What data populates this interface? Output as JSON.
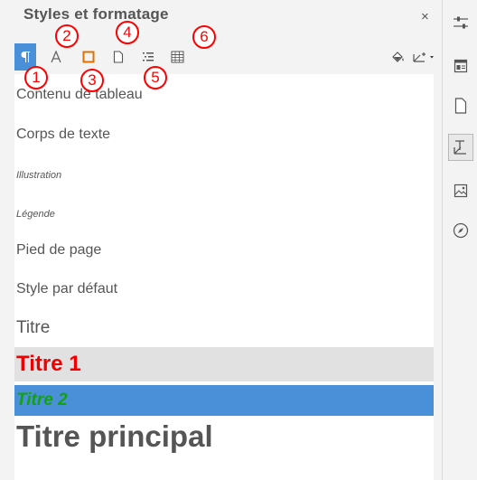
{
  "panel": {
    "title": "Styles et formatage",
    "close_label": "×"
  },
  "toolbar": {
    "buttons": [
      {
        "name": "paragraph-styles",
        "icon": "pilcrow-icon",
        "active": true
      },
      {
        "name": "character-styles",
        "icon": "character-a-icon"
      },
      {
        "name": "frame-styles",
        "icon": "frame-icon"
      },
      {
        "name": "page-styles",
        "icon": "page-icon"
      },
      {
        "name": "list-styles",
        "icon": "list-icon"
      },
      {
        "name": "table-styles",
        "icon": "table-icon"
      }
    ],
    "right_buttons": [
      {
        "name": "fill-format-mode",
        "icon": "paint-bucket-icon"
      },
      {
        "name": "new-style-from-selection",
        "icon": "new-style-icon"
      }
    ]
  },
  "annotations": [
    "1",
    "2",
    "3",
    "4",
    "5",
    "6"
  ],
  "styles": [
    {
      "label": "Contenu de tableau"
    },
    {
      "label": "Corps de texte"
    },
    {
      "label": "Illustration"
    },
    {
      "label": "Légende"
    },
    {
      "label": "Pied de page"
    },
    {
      "label": "Style par défaut"
    },
    {
      "label": "Titre"
    },
    {
      "label": "Titre 1"
    },
    {
      "label": "Titre 2",
      "selected": true
    },
    {
      "label": "Titre principal"
    }
  ],
  "colors": {
    "accent": "#4a90d9",
    "annotation": "#ff0000",
    "titre1": "#ee0000",
    "titre2": "#14a014",
    "hover_row": "#e1e1e1"
  },
  "sidebar": {
    "buttons": [
      {
        "name": "properties",
        "icon": "sliders-icon"
      },
      {
        "name": "page-deck",
        "icon": "layout-icon"
      },
      {
        "name": "page",
        "icon": "page-icon"
      },
      {
        "name": "styles",
        "icon": "styles-icon",
        "active": true
      },
      {
        "name": "gallery",
        "icon": "image-icon"
      },
      {
        "name": "navigator",
        "icon": "compass-icon"
      }
    ]
  }
}
